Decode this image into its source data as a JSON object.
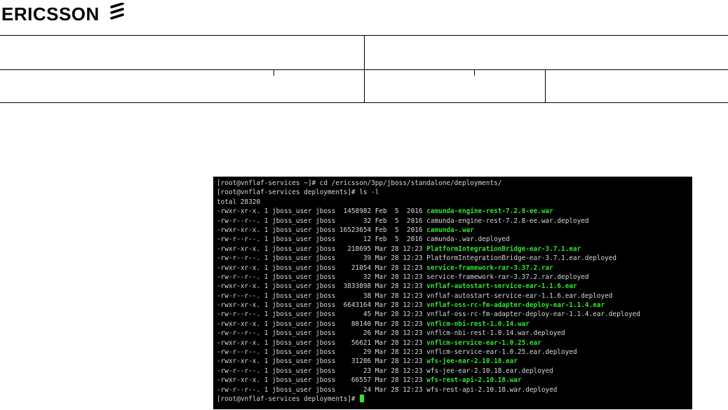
{
  "brand": {
    "name": "ERICSSON"
  },
  "header_table": {
    "row1": [
      "",
      ""
    ],
    "row2": [
      "",
      "",
      ""
    ]
  },
  "terminal": {
    "prompt": "[root@vnflaf-services deployments]# ",
    "lines": [
      {
        "text": "[root@vnflaf-services ~]# cd /ericsson/3pp/jboss/standalone/deployments/"
      },
      {
        "text": "[root@vnflaf-services deployments]# ls -l"
      },
      {
        "text": "total 28320"
      },
      {
        "meta": "-rwxr-xr-x. 1 jboss_user jboss  1458982 Feb  5  2016 ",
        "file": "camunda-engine-rest-7.2.8-ee.war",
        "highlight": true
      },
      {
        "meta": "-rw-r--r--. 1 jboss_user jboss       32 Feb  5  2016 ",
        "file": "camunda-engine-rest-7.2.8-ee.war.deployed",
        "highlight": false
      },
      {
        "meta": "-rwxr-xr-x. 1 jboss_user jboss 16523654 Feb  5  2016 ",
        "file": "camunda-.war",
        "highlight": true
      },
      {
        "meta": "-rw-r--r--. 1 jboss_user jboss       12 Feb  5  2016 ",
        "file": "camunda-.war.deployed",
        "highlight": false
      },
      {
        "meta": "-rwxr-xr-x. 1 jboss_user jboss   218695 Mar 28 12:23 ",
        "file": "PlatformIntegrationBridge-ear-3.7.1.ear",
        "highlight": true
      },
      {
        "meta": "-rw-r--r--. 1 jboss_user jboss       39 Mar 28 12:23 ",
        "file": "PlatformIntegrationBridge-ear-3.7.1.ear.deployed",
        "highlight": false
      },
      {
        "meta": "-rwxr-xr-x. 1 jboss_user jboss    21054 Mar 28 12:23 ",
        "file": "service-framework-rar-3.37.2.rar",
        "highlight": true
      },
      {
        "meta": "-rw-r--r--. 1 jboss_user jboss       32 Mar 28 12:23 ",
        "file": "service-framework-rar-3.37.2.rar.deployed",
        "highlight": false
      },
      {
        "meta": "-rwxr-xr-x. 1 jboss_user jboss  3833898 Mar 28 12:23 ",
        "file": "vnflaf-autostart-service-ear-1.1.6.ear",
        "highlight": true
      },
      {
        "meta": "-rw-r--r--. 1 jboss_user jboss       38 Mar 28 12:23 ",
        "file": "vnflaf-autostart-service-ear-1.1.6.ear.deployed",
        "highlight": false
      },
      {
        "meta": "-rwxr-xr-x. 1 jboss_user jboss  6643164 Mar 28 12:23 ",
        "file": "vnflaf-oss-rc-fm-adapter-deploy-ear-1.1.4.ear",
        "highlight": true
      },
      {
        "meta": "-rw-r--r--. 1 jboss_user jboss       45 Mar 28 12:23 ",
        "file": "vnflaf-oss-rc-fm-adapter-deploy-ear-1.1.4.ear.deployed",
        "highlight": false
      },
      {
        "meta": "-rwxr-xr-x. 1 jboss_user jboss    80140 Mar 28 12:23 ",
        "file": "vnflcm-nbi-rest-1.0.14.war",
        "highlight": true
      },
      {
        "meta": "-rw-r--r--. 1 jboss_user jboss       26 Mar 28 12:23 ",
        "file": "vnflcm-nbi-rest-1.0.14.war.deployed",
        "highlight": false
      },
      {
        "meta": "-rwxr-xr-x. 1 jboss_user jboss    56621 Mar 28 12:23 ",
        "file": "vnflcm-service-ear-1.0.25.ear",
        "highlight": true
      },
      {
        "meta": "-rw-r--r--. 1 jboss_user jboss       29 Mar 28 12:23 ",
        "file": "vnflcm-service-ear-1.0.25.ear.deployed",
        "highlight": false
      },
      {
        "meta": "-rwxr-xr-x. 1 jboss_user jboss    31286 Mar 28 12:23 ",
        "file": "wfs-jee-ear-2.10.18.ear",
        "highlight": true
      },
      {
        "meta": "-rw-r--r--. 1 jboss_user jboss       23 Mar 28 12:23 ",
        "file": "wfs-jee-ear-2.10.18.ear.deployed",
        "highlight": false
      },
      {
        "meta": "-rwxr-xr-x. 1 jboss_user jboss    66557 Mar 28 12:23 ",
        "file": "wfs-rest-api-2.10.18.war",
        "highlight": true
      },
      {
        "meta": "-rw-r--r--. 1 jboss_user jboss       24 Mar 28 12:23 ",
        "file": "wfs-rest-api-2.10.18.war.deployed",
        "highlight": false
      }
    ],
    "colors": {
      "background": "#000000",
      "text": "#d8d8d8",
      "executable": "#2ee62e"
    }
  }
}
